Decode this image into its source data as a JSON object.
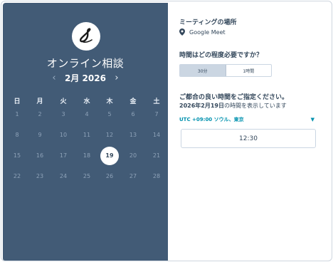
{
  "left_panel": {
    "title": "オンライン相談",
    "month_label": "2月 2026",
    "prev_arrow": "‹",
    "next_arrow": "›",
    "weekdays": [
      "日",
      "月",
      "火",
      "水",
      "木",
      "金",
      "土"
    ],
    "weeks": [
      [
        "1",
        "2",
        "3",
        "4",
        "5",
        "6",
        "7"
      ],
      [
        "8",
        "9",
        "10",
        "11",
        "12",
        "13",
        "14"
      ],
      [
        "15",
        "16",
        "17",
        "18",
        "19",
        "20",
        "21"
      ],
      [
        "22",
        "23",
        "24",
        "25",
        "26",
        "27",
        "28"
      ]
    ],
    "selected_day": "19",
    "colors": {
      "panel_bg": "#425b76",
      "day_text": "#8ea2b8",
      "selected_bg": "#ffffff"
    }
  },
  "right_panel": {
    "location_heading": "ミーティングの場所",
    "location_icon": "map-pin-icon",
    "location_value": "Google Meet",
    "duration_heading": "時間はどの程度必要ですか？",
    "duration_options": [
      "30分",
      "1時間"
    ],
    "duration_selected": "30分",
    "time_heading": "ご都合の良い時間をご指定ください。",
    "date_bold": "2026年2月19日",
    "date_suffix": "の時間を表示しています",
    "timezone": "UTC +09:00 ソウル、東京",
    "timezone_icon": "caret-down-icon",
    "time_slots": [
      "12:30"
    ],
    "accent_color": "#0091ae"
  }
}
